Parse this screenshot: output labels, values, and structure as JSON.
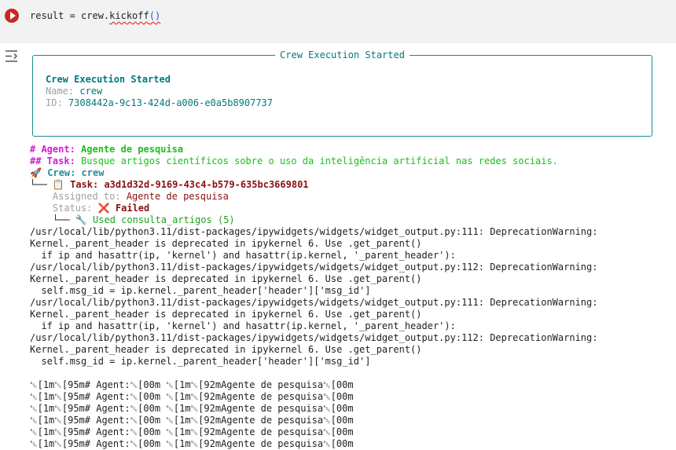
{
  "cell": {
    "code_prefix": "result = crew.",
    "code_method": "kickoff",
    "code_parens": "()"
  },
  "panel": {
    "title": "Crew Execution Started",
    "heading": "Crew Execution Started",
    "name_label": "Name:",
    "name_value": "crew",
    "id_label": "ID:",
    "id_value": "7308442a-9c13-424d-a006-e0a5b8907737"
  },
  "agent": {
    "prefix": "# Agent: ",
    "name": "Agente de pesquisa"
  },
  "task": {
    "prefix": "## Task: ",
    "text": "Busque artigos científicos sobre o uso da inteligência artificial nas redes sociais."
  },
  "tree": {
    "crew_icon": "🚀",
    "crew_label": "Crew: crew",
    "branch1": "└── ",
    "task_icon": "📋",
    "task_label": "Task: a3d1d32d-9169-43c4-b579-635bc3669801",
    "assigned_label": "Assigned to: ",
    "assigned_value": "Agente de pesquisa",
    "status_label": "Status: ",
    "status_icon": "❌",
    "status_value": "Failed",
    "branch2": "└── ",
    "tool_icon": "🔧",
    "tool_label": "Used consulta_artigos (5)"
  },
  "warnings": [
    "/usr/local/lib/python3.11/dist-packages/ipywidgets/widgets/widget_output.py:111: DeprecationWarning:",
    "Kernel._parent_header is deprecated in ipykernel 6. Use .get_parent()",
    "  if ip and hasattr(ip, 'kernel') and hasattr(ip.kernel, '_parent_header'):",
    "/usr/local/lib/python3.11/dist-packages/ipywidgets/widgets/widget_output.py:112: DeprecationWarning:",
    "Kernel._parent_header is deprecated in ipykernel 6. Use .get_parent()",
    "  self.msg_id = ip.kernel._parent_header['header']['msg_id']",
    "/usr/local/lib/python3.11/dist-packages/ipywidgets/widgets/widget_output.py:111: DeprecationWarning:",
    "Kernel._parent_header is deprecated in ipykernel 6. Use .get_parent()",
    "  if ip and hasattr(ip, 'kernel') and hasattr(ip.kernel, '_parent_header'):",
    "/usr/local/lib/python3.11/dist-packages/ipywidgets/widgets/widget_output.py:112: DeprecationWarning:",
    "Kernel._parent_header is deprecated in ipykernel 6. Use .get_parent()",
    "  self.msg_id = ip.kernel._parent_header['header']['msg_id']"
  ],
  "ansi_lines": [
    "␛[1m␛[95m# Agent:␛[00m ␛[1m␛[92mAgente de pesquisa␛[00m",
    "␛[1m␛[95m# Agent:␛[00m ␛[1m␛[92mAgente de pesquisa␛[00m",
    "␛[1m␛[95m# Agent:␛[00m ␛[1m␛[92mAgente de pesquisa␛[00m",
    "␛[1m␛[95m# Agent:␛[00m ␛[1m␛[92mAgente de pesquisa␛[00m",
    "␛[1m␛[95m# Agent:␛[00m ␛[1m␛[92mAgente de pesquisa␛[00m",
    "␛[1m␛[95m# Agent:␛[00m ␛[1m␛[92mAgente de pesquisa␛[00m"
  ],
  "colors": {
    "run_button": "#c62828",
    "panel_border": "#1a8a8a",
    "agent_magenta": "#d61ad6",
    "task_green": "#19c119",
    "failed_maroon": "#8b1010"
  },
  "icons": {
    "run": "play-circle-icon",
    "output": "output-collapse-icon"
  }
}
